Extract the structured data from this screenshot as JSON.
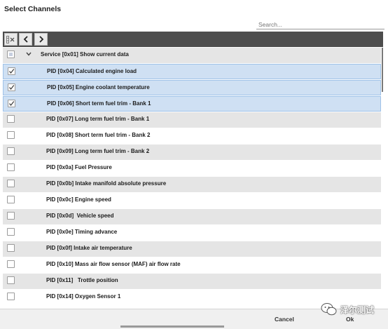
{
  "dialog": {
    "title": "Select Channels"
  },
  "search": {
    "placeholder": "Search..."
  },
  "toolbar": {
    "clear_icon": "clear-selection-icon",
    "back_icon": "chevron-left-icon",
    "forward_icon": "chevron-right-icon"
  },
  "tree": {
    "group": {
      "label": "Service [0x01] Show current data",
      "checked": "partial",
      "expanded": true
    },
    "items": [
      {
        "label": "PID [0x04] Calculated engine load",
        "checked": true
      },
      {
        "label": "PID [0x05] Engine coolant temperature",
        "checked": true
      },
      {
        "label": "PID [0x06] Short term fuel trim - Bank 1",
        "checked": true
      },
      {
        "label": "PID [0x07] Long term fuel trim - Bank 1",
        "checked": false
      },
      {
        "label": "PID [0x08] Short term fuel trim - Bank 2",
        "checked": false
      },
      {
        "label": "PID [0x09] Long term fuel trim - Bank 2",
        "checked": false
      },
      {
        "label": "PID [0x0a] Fuel Pressure",
        "checked": false
      },
      {
        "label": "PID [0x0b] Intake manifold absolute pressure",
        "checked": false
      },
      {
        "label": "PID [0x0c] Engine speed",
        "checked": false
      },
      {
        "label": "PID [0x0d]  Vehicle speed",
        "checked": false
      },
      {
        "label": "PID [0x0e] Timing advance",
        "checked": false
      },
      {
        "label": "PID [0x0f] Intake air temperature",
        "checked": false
      },
      {
        "label": "PID [0x10] Mass air flow sensor (MAF) air flow rate",
        "checked": false
      },
      {
        "label": "PID [0x11]   Trottle position",
        "checked": false
      },
      {
        "label": "PID [0x14] Oxygen Sensor 1",
        "checked": false
      }
    ]
  },
  "footer": {
    "cancel_label": "Cancel",
    "ok_label": "Ok"
  },
  "watermark": {
    "text": "泽尔测试"
  },
  "colors": {
    "selected_row": "#cfe0f3",
    "toolbar": "#4d4d4d",
    "alt_row": "#e5e5e5"
  }
}
